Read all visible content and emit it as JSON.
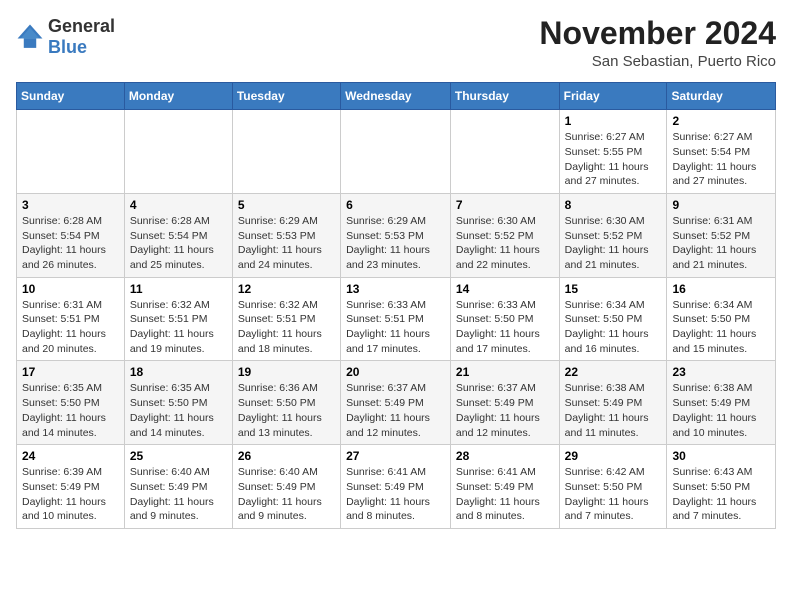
{
  "logo": {
    "general": "General",
    "blue": "Blue"
  },
  "title": {
    "month": "November 2024",
    "location": "San Sebastian, Puerto Rico"
  },
  "days_of_week": [
    "Sunday",
    "Monday",
    "Tuesday",
    "Wednesday",
    "Thursday",
    "Friday",
    "Saturday"
  ],
  "weeks": [
    [
      {
        "day": "",
        "info": ""
      },
      {
        "day": "",
        "info": ""
      },
      {
        "day": "",
        "info": ""
      },
      {
        "day": "",
        "info": ""
      },
      {
        "day": "",
        "info": ""
      },
      {
        "day": "1",
        "info": "Sunrise: 6:27 AM\nSunset: 5:55 PM\nDaylight: 11 hours and 27 minutes."
      },
      {
        "day": "2",
        "info": "Sunrise: 6:27 AM\nSunset: 5:54 PM\nDaylight: 11 hours and 27 minutes."
      }
    ],
    [
      {
        "day": "3",
        "info": "Sunrise: 6:28 AM\nSunset: 5:54 PM\nDaylight: 11 hours and 26 minutes."
      },
      {
        "day": "4",
        "info": "Sunrise: 6:28 AM\nSunset: 5:54 PM\nDaylight: 11 hours and 25 minutes."
      },
      {
        "day": "5",
        "info": "Sunrise: 6:29 AM\nSunset: 5:53 PM\nDaylight: 11 hours and 24 minutes."
      },
      {
        "day": "6",
        "info": "Sunrise: 6:29 AM\nSunset: 5:53 PM\nDaylight: 11 hours and 23 minutes."
      },
      {
        "day": "7",
        "info": "Sunrise: 6:30 AM\nSunset: 5:52 PM\nDaylight: 11 hours and 22 minutes."
      },
      {
        "day": "8",
        "info": "Sunrise: 6:30 AM\nSunset: 5:52 PM\nDaylight: 11 hours and 21 minutes."
      },
      {
        "day": "9",
        "info": "Sunrise: 6:31 AM\nSunset: 5:52 PM\nDaylight: 11 hours and 21 minutes."
      }
    ],
    [
      {
        "day": "10",
        "info": "Sunrise: 6:31 AM\nSunset: 5:51 PM\nDaylight: 11 hours and 20 minutes."
      },
      {
        "day": "11",
        "info": "Sunrise: 6:32 AM\nSunset: 5:51 PM\nDaylight: 11 hours and 19 minutes."
      },
      {
        "day": "12",
        "info": "Sunrise: 6:32 AM\nSunset: 5:51 PM\nDaylight: 11 hours and 18 minutes."
      },
      {
        "day": "13",
        "info": "Sunrise: 6:33 AM\nSunset: 5:51 PM\nDaylight: 11 hours and 17 minutes."
      },
      {
        "day": "14",
        "info": "Sunrise: 6:33 AM\nSunset: 5:50 PM\nDaylight: 11 hours and 17 minutes."
      },
      {
        "day": "15",
        "info": "Sunrise: 6:34 AM\nSunset: 5:50 PM\nDaylight: 11 hours and 16 minutes."
      },
      {
        "day": "16",
        "info": "Sunrise: 6:34 AM\nSunset: 5:50 PM\nDaylight: 11 hours and 15 minutes."
      }
    ],
    [
      {
        "day": "17",
        "info": "Sunrise: 6:35 AM\nSunset: 5:50 PM\nDaylight: 11 hours and 14 minutes."
      },
      {
        "day": "18",
        "info": "Sunrise: 6:35 AM\nSunset: 5:50 PM\nDaylight: 11 hours and 14 minutes."
      },
      {
        "day": "19",
        "info": "Sunrise: 6:36 AM\nSunset: 5:50 PM\nDaylight: 11 hours and 13 minutes."
      },
      {
        "day": "20",
        "info": "Sunrise: 6:37 AM\nSunset: 5:49 PM\nDaylight: 11 hours and 12 minutes."
      },
      {
        "day": "21",
        "info": "Sunrise: 6:37 AM\nSunset: 5:49 PM\nDaylight: 11 hours and 12 minutes."
      },
      {
        "day": "22",
        "info": "Sunrise: 6:38 AM\nSunset: 5:49 PM\nDaylight: 11 hours and 11 minutes."
      },
      {
        "day": "23",
        "info": "Sunrise: 6:38 AM\nSunset: 5:49 PM\nDaylight: 11 hours and 10 minutes."
      }
    ],
    [
      {
        "day": "24",
        "info": "Sunrise: 6:39 AM\nSunset: 5:49 PM\nDaylight: 11 hours and 10 minutes."
      },
      {
        "day": "25",
        "info": "Sunrise: 6:40 AM\nSunset: 5:49 PM\nDaylight: 11 hours and 9 minutes."
      },
      {
        "day": "26",
        "info": "Sunrise: 6:40 AM\nSunset: 5:49 PM\nDaylight: 11 hours and 9 minutes."
      },
      {
        "day": "27",
        "info": "Sunrise: 6:41 AM\nSunset: 5:49 PM\nDaylight: 11 hours and 8 minutes."
      },
      {
        "day": "28",
        "info": "Sunrise: 6:41 AM\nSunset: 5:49 PM\nDaylight: 11 hours and 8 minutes."
      },
      {
        "day": "29",
        "info": "Sunrise: 6:42 AM\nSunset: 5:50 PM\nDaylight: 11 hours and 7 minutes."
      },
      {
        "day": "30",
        "info": "Sunrise: 6:43 AM\nSunset: 5:50 PM\nDaylight: 11 hours and 7 minutes."
      }
    ]
  ]
}
